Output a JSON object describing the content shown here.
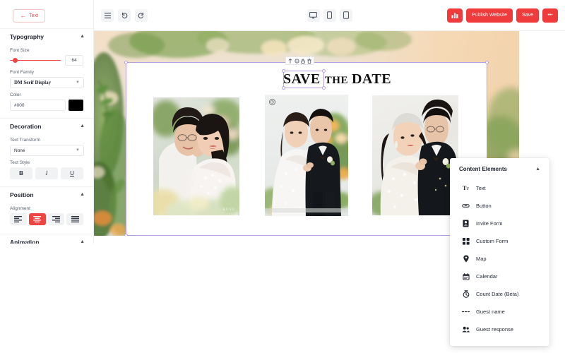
{
  "sidebar": {
    "back_button": {
      "label": "Text",
      "icon": "arrow-left-icon"
    },
    "sections": [
      {
        "id": "typography",
        "title": "Typography",
        "collapse_icon": "chevron-up-icon",
        "fields": {
          "font_size_label": "Font Size",
          "font_size_value": "64",
          "font_family_label": "Font Family",
          "font_family_value": "DM Serif Display",
          "color_label": "Color",
          "color_value": "#000",
          "color_swatch": "#000000"
        }
      },
      {
        "id": "decoration",
        "title": "Decoration",
        "collapse_icon": "chevron-up-icon",
        "fields": {
          "text_transform_label": "Text Transform",
          "text_transform_value": "None",
          "text_style_label": "Text Style",
          "bold_label": "B",
          "italic_label": "I",
          "underline_label": "U"
        }
      },
      {
        "id": "position",
        "title": "Position",
        "collapse_icon": "chevron-up-icon",
        "fields": {
          "alignment_label": "Alignment",
          "alignment_options": [
            "align-left",
            "align-center",
            "align-right",
            "align-justify"
          ],
          "alignment_active": "align-center"
        }
      },
      {
        "id": "animation",
        "title": "Animation",
        "collapse_icon": "chevron-up-icon"
      }
    ]
  },
  "toolbar": {
    "left_icons": [
      "menu-icon",
      "undo-icon",
      "redo-icon"
    ],
    "viewport_icons": [
      "desktop-icon",
      "mobile-icon",
      "tablet-icon"
    ],
    "analytics_icon": "bar-chart-icon",
    "publish_label": "Publish Website",
    "save_label": "Save",
    "more_label": "•••",
    "accent_color": "#ef3b3b"
  },
  "canvas": {
    "selection_color": "#b99fe0",
    "element_toolbar_icons": [
      "move-icon",
      "settings-icon",
      "lock-icon",
      "trash-icon"
    ],
    "title": {
      "word1": "SAVE",
      "word2": "THE",
      "word3": "DATE"
    },
    "photos": [
      {
        "name": "photo-couple-left",
        "watermark": "KUSU"
      },
      {
        "name": "photo-couple-center",
        "badge_icon": "clock-icon"
      },
      {
        "name": "photo-couple-right"
      }
    ]
  },
  "content_elements": {
    "title": "Content Elements",
    "collapse_icon": "chevron-up-icon",
    "items": [
      {
        "label": "Text",
        "icon": "text-format-icon"
      },
      {
        "label": "Button",
        "icon": "button-icon"
      },
      {
        "label": "Invite Form",
        "icon": "invite-form-icon"
      },
      {
        "label": "Custom Form",
        "icon": "custom-form-icon"
      },
      {
        "label": "Map",
        "icon": "map-pin-icon"
      },
      {
        "label": "Calendar",
        "icon": "calendar-icon"
      },
      {
        "label": "Count Date (Beta)",
        "icon": "timer-icon"
      },
      {
        "label": "Guest name",
        "icon": "guest-name-icon"
      },
      {
        "label": "Guest response",
        "icon": "guests-icon"
      }
    ]
  }
}
